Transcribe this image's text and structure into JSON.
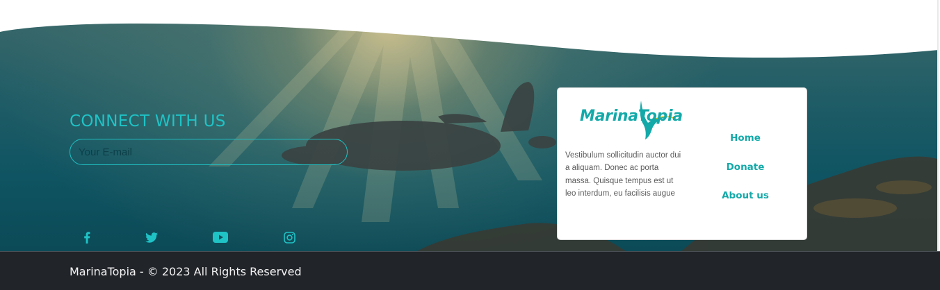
{
  "connect": {
    "title": "CONNECT WITH US",
    "email_placeholder": "Your E-mail"
  },
  "social": [
    {
      "icon": "facebook-icon"
    },
    {
      "icon": "twitter-icon"
    },
    {
      "icon": "youtube-icon"
    },
    {
      "icon": "instagram-icon"
    }
  ],
  "card": {
    "logo_text": "MarinaTopia",
    "description": "Vestibulum sollicitudin auctor dui a aliquam. Donec ac porta massa. Quisque tempus est ut leo interdum, eu facilisis augue",
    "links": [
      "Home",
      "Donate",
      "About us"
    ]
  },
  "footer": {
    "copyright": "MarinaTopia - © 2023 All Rights Reserved"
  },
  "colors": {
    "accent": "#1fc3c6",
    "brand": "#14a9a9",
    "footer_bg": "#212429"
  }
}
